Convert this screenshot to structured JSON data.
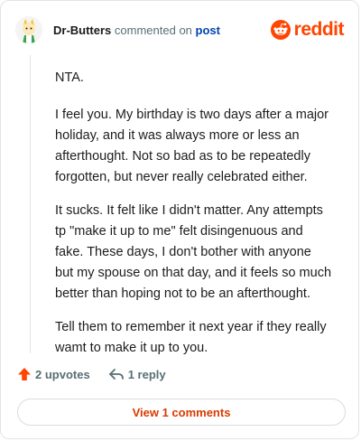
{
  "header": {
    "author": "Dr-Butters",
    "action_text": "commented on",
    "post_link": "post",
    "logo_text": "reddit"
  },
  "comment": {
    "paragraphs": [
      "NTA.",
      "I feel you. My birthday is two days after a major holiday, and it was always more or less an afterthought. Not so bad as to be repeatedly forgotten, but never really celebrated either.",
      "It sucks. It felt like I didn't matter. Any attempts tp \"make it up to me\" felt disingenuous and fake. These days, I don't bother with anyone but my spouse on that day, and it feels so much better than hoping not to be an afterthought.",
      "Tell them to remember it next year if they really wamt to make it up to you."
    ]
  },
  "actions": {
    "upvotes_label": "2 upvotes",
    "reply_label": "1 reply"
  },
  "footer": {
    "view_label": "View 1 comments"
  },
  "colors": {
    "brand": "#ff4500",
    "link": "#0045ac",
    "muted": "#576f76"
  }
}
